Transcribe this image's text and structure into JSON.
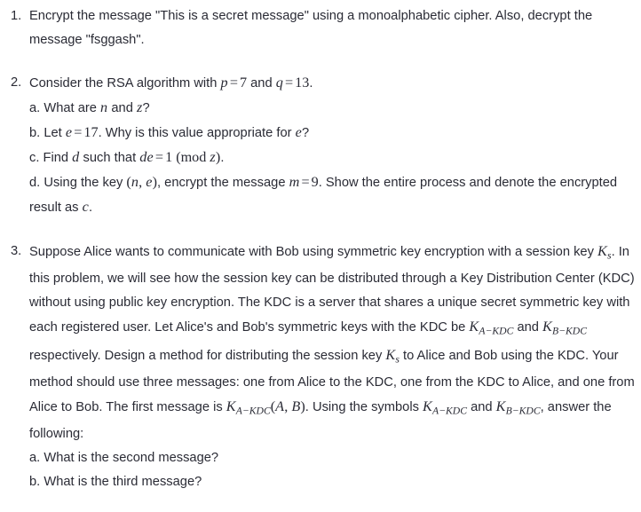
{
  "document": {
    "type": "homework-problem-set",
    "background_color": "#ffffff",
    "text_color": "#2a2b35"
  },
  "problems": [
    {
      "number": "1.",
      "body_segments": [
        {
          "t": "text",
          "v": "Encrypt the message \"This is a secret message\" using a monoalphabetic cipher. Also, decrypt the message \"fsggash\"."
        }
      ],
      "subitems": []
    },
    {
      "number": "2.",
      "body_segments": [
        {
          "t": "text",
          "v": "Consider the RSA algorithm with "
        },
        {
          "t": "math",
          "v": "p"
        },
        {
          "t": "op",
          "v": "="
        },
        {
          "t": "mathroman",
          "v": "7"
        },
        {
          "t": "text",
          "v": " and "
        },
        {
          "t": "math",
          "v": "q"
        },
        {
          "t": "op",
          "v": "="
        },
        {
          "t": "mathroman",
          "v": "13"
        },
        {
          "t": "text",
          "v": "."
        }
      ],
      "subitems": [
        {
          "label": "a.",
          "segments": [
            {
              "t": "text",
              "v": "What are "
            },
            {
              "t": "math",
              "v": "n"
            },
            {
              "t": "text",
              "v": " and "
            },
            {
              "t": "math",
              "v": "z"
            },
            {
              "t": "text",
              "v": "?"
            }
          ]
        },
        {
          "label": "b.",
          "segments": [
            {
              "t": "text",
              "v": "Let "
            },
            {
              "t": "math",
              "v": "e"
            },
            {
              "t": "op",
              "v": "="
            },
            {
              "t": "mathroman",
              "v": "17"
            },
            {
              "t": "text",
              "v": ". Why is this value appropriate for "
            },
            {
              "t": "math",
              "v": "e"
            },
            {
              "t": "text",
              "v": "?"
            }
          ]
        },
        {
          "label": "c.",
          "segments": [
            {
              "t": "text",
              "v": "Find "
            },
            {
              "t": "math",
              "v": "d"
            },
            {
              "t": "text",
              "v": " such that "
            },
            {
              "t": "math",
              "v": "de"
            },
            {
              "t": "op",
              "v": "="
            },
            {
              "t": "mathroman",
              "v": "1"
            },
            {
              "t": "mathroman",
              "v": " (mod "
            },
            {
              "t": "math",
              "v": "z"
            },
            {
              "t": "mathroman",
              "v": ")"
            },
            {
              "t": "text",
              "v": "."
            }
          ]
        },
        {
          "label": "d.",
          "segments": [
            {
              "t": "text",
              "v": "Using the key "
            },
            {
              "t": "mathroman",
              "v": "("
            },
            {
              "t": "math",
              "v": "n"
            },
            {
              "t": "mathroman",
              "v": ", "
            },
            {
              "t": "math",
              "v": "e"
            },
            {
              "t": "mathroman",
              "v": ")"
            },
            {
              "t": "text",
              "v": ", encrypt the message "
            },
            {
              "t": "math",
              "v": "m"
            },
            {
              "t": "op",
              "v": "="
            },
            {
              "t": "mathroman",
              "v": "9"
            },
            {
              "t": "text",
              "v": ". Show the entire process and denote the encrypted result as "
            },
            {
              "t": "math",
              "v": "c"
            },
            {
              "t": "text",
              "v": "."
            }
          ]
        }
      ]
    },
    {
      "number": "3.",
      "body_segments": [
        {
          "t": "text",
          "v": "Suppose Alice wants to communicate with Bob using symmetric key encryption with a session key "
        },
        {
          "t": "mathsub",
          "base": "K",
          "sub": "s"
        },
        {
          "t": "text",
          "v": ". In this problem, we will see how the session key can be distributed through a Key Distribution Center (KDC) without using public key encryption. The KDC is a server that shares a unique secret symmetric key with each registered user. Let Alice's and Bob's symmetric keys with the KDC be "
        },
        {
          "t": "mathsub",
          "base": "K",
          "sub": "A−KDC"
        },
        {
          "t": "text",
          "v": " and "
        },
        {
          "t": "mathsub",
          "base": "K",
          "sub": "B−KDC"
        },
        {
          "t": "text",
          "v": " respectively. Design a method for distributing the session key "
        },
        {
          "t": "mathsub",
          "base": "K",
          "sub": "s"
        },
        {
          "t": "text",
          "v": " to Alice and Bob using the KDC. Your method should use three messages: one from Alice to the KDC, one from the KDC to Alice, and one from Alice to Bob. The first message is "
        },
        {
          "t": "mathsub",
          "base": "K",
          "sub": "A−KDC"
        },
        {
          "t": "mathroman",
          "v": "("
        },
        {
          "t": "math",
          "v": "A"
        },
        {
          "t": "mathroman",
          "v": ", "
        },
        {
          "t": "math",
          "v": "B"
        },
        {
          "t": "mathroman",
          "v": ")"
        },
        {
          "t": "text",
          "v": ". Using the symbols "
        },
        {
          "t": "mathsub",
          "base": "K",
          "sub": "A−KDC"
        },
        {
          "t": "text",
          "v": " and "
        },
        {
          "t": "mathsub",
          "base": "K",
          "sub": "B−KDC"
        },
        {
          "t": "text",
          "v": ", answer the following:"
        }
      ],
      "subitems": [
        {
          "label": "a.",
          "segments": [
            {
              "t": "text",
              "v": "What is the second message?"
            }
          ]
        },
        {
          "label": "b.",
          "segments": [
            {
              "t": "text",
              "v": "What is the third message?"
            }
          ]
        }
      ]
    }
  ]
}
